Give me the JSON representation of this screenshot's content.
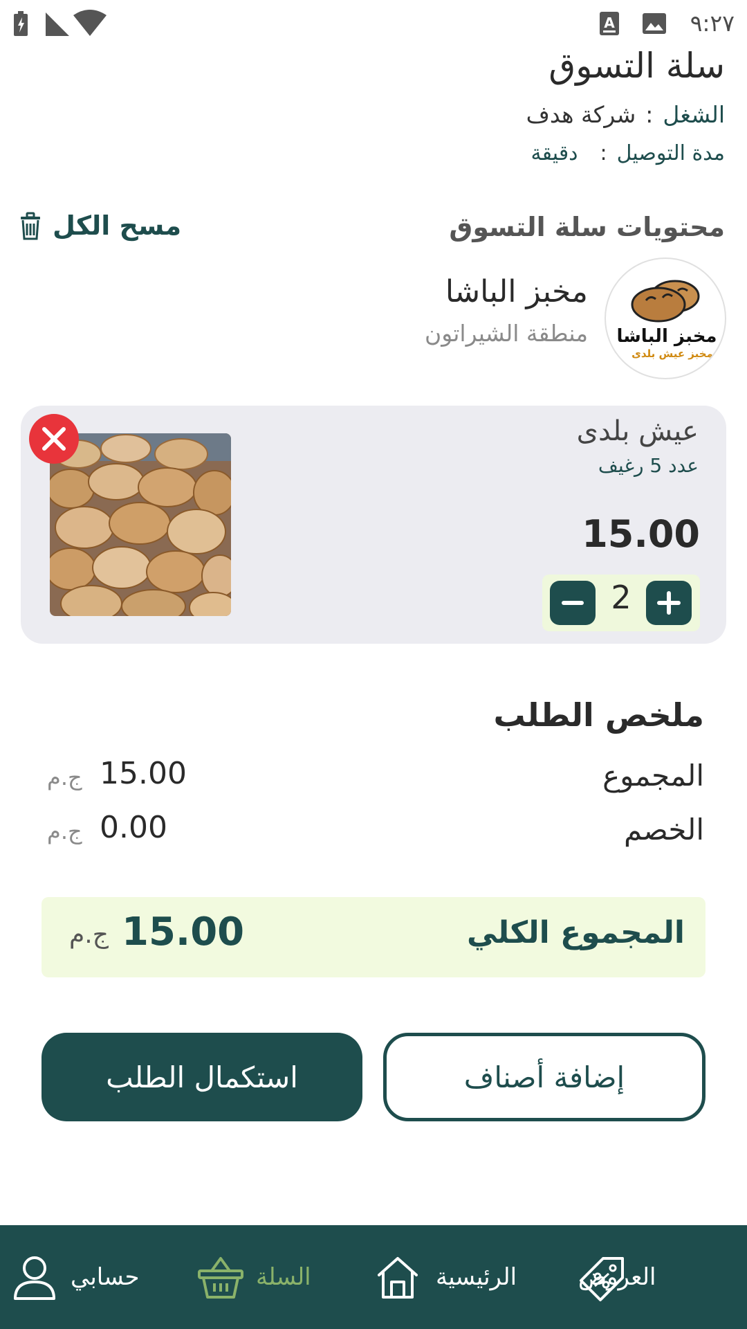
{
  "status_bar": {
    "time": "٩:٢٧"
  },
  "header": {
    "title": "سلة التسوق",
    "work_label": "الشغل",
    "work_colon": ":",
    "work_value": "شركة هدف",
    "delivery_label": "مدة التوصيل",
    "delivery_colon": ":",
    "delivery_value": "دقيقة"
  },
  "cart": {
    "section_title": "محتويات سلة التسوق",
    "clear_all_label": "مسح الكل",
    "store": {
      "name": "مخبز الباشا",
      "area": "منطقة الشيراتون",
      "logo_title": "مخبز الباشا",
      "logo_subtitle": "مخبز عيش بلدى"
    },
    "items": [
      {
        "name": "عيش بلدى",
        "description": "عدد 5 رغيف",
        "price": "15.00",
        "quantity": "2"
      }
    ]
  },
  "summary": {
    "title": "ملخص الطلب",
    "subtotal_label": "المجموع",
    "subtotal_amount": "15.00",
    "discount_label": "الخصم",
    "discount_amount": "0.00",
    "currency": "ج.م",
    "total_label": "المجموع الكلي",
    "total_amount": "15.00"
  },
  "actions": {
    "checkout_label": "استكمال الطلب",
    "add_items_label": "إضافة أصناف"
  },
  "bottom_nav": {
    "offers": "العروض",
    "home": "الرئيسية",
    "cart": "السلة",
    "account": "حسابي",
    "active": "cart"
  },
  "colors": {
    "primary": "#1e4d4d",
    "accent_light": "#f2fadf",
    "nav_active": "#8ab26a",
    "danger": "#e8343b",
    "card_bg": "#ececf1"
  },
  "icons": [
    "battery-icon",
    "signal-icon",
    "wifi-icon",
    "keyboard-a-icon",
    "image-icon",
    "trash-icon",
    "close-icon",
    "minus-icon",
    "plus-icon",
    "offers-tag-icon",
    "home-icon",
    "basket-icon",
    "user-icon"
  ]
}
